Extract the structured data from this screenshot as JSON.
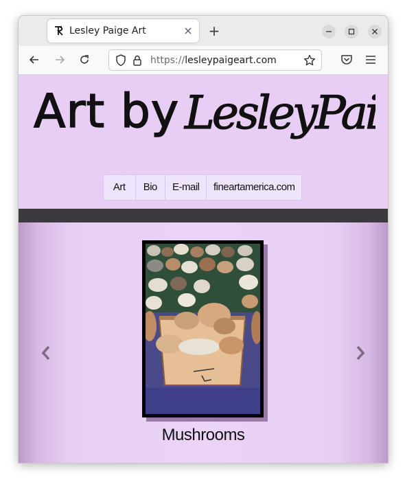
{
  "browser": {
    "tab_title": "Lesley Paige Art",
    "tab_close_glyph": "×",
    "new_tab_glyph": "+",
    "url_scheme": "https://",
    "url_host": "lesleypaigeart.com",
    "icons": [
      "tab-favicon",
      "back-arrow",
      "forward-arrow",
      "reload",
      "shield",
      "lock",
      "bookmark-star",
      "pocket",
      "hamburger-menu",
      "minimize",
      "maximize",
      "close"
    ]
  },
  "site": {
    "logo_text": "Art by LesleyPaige",
    "nav": [
      "Art",
      "Bio",
      "E-mail",
      "fineartamerica.com"
    ],
    "colors": {
      "header_bg": "#e8cdf5",
      "band": "#3d3a3f",
      "gallery_center": "#ebd4f7"
    }
  },
  "gallery": {
    "caption": "Mushrooms",
    "prev_icon": "chevron-left-icon",
    "next_icon": "chevron-right-icon"
  }
}
